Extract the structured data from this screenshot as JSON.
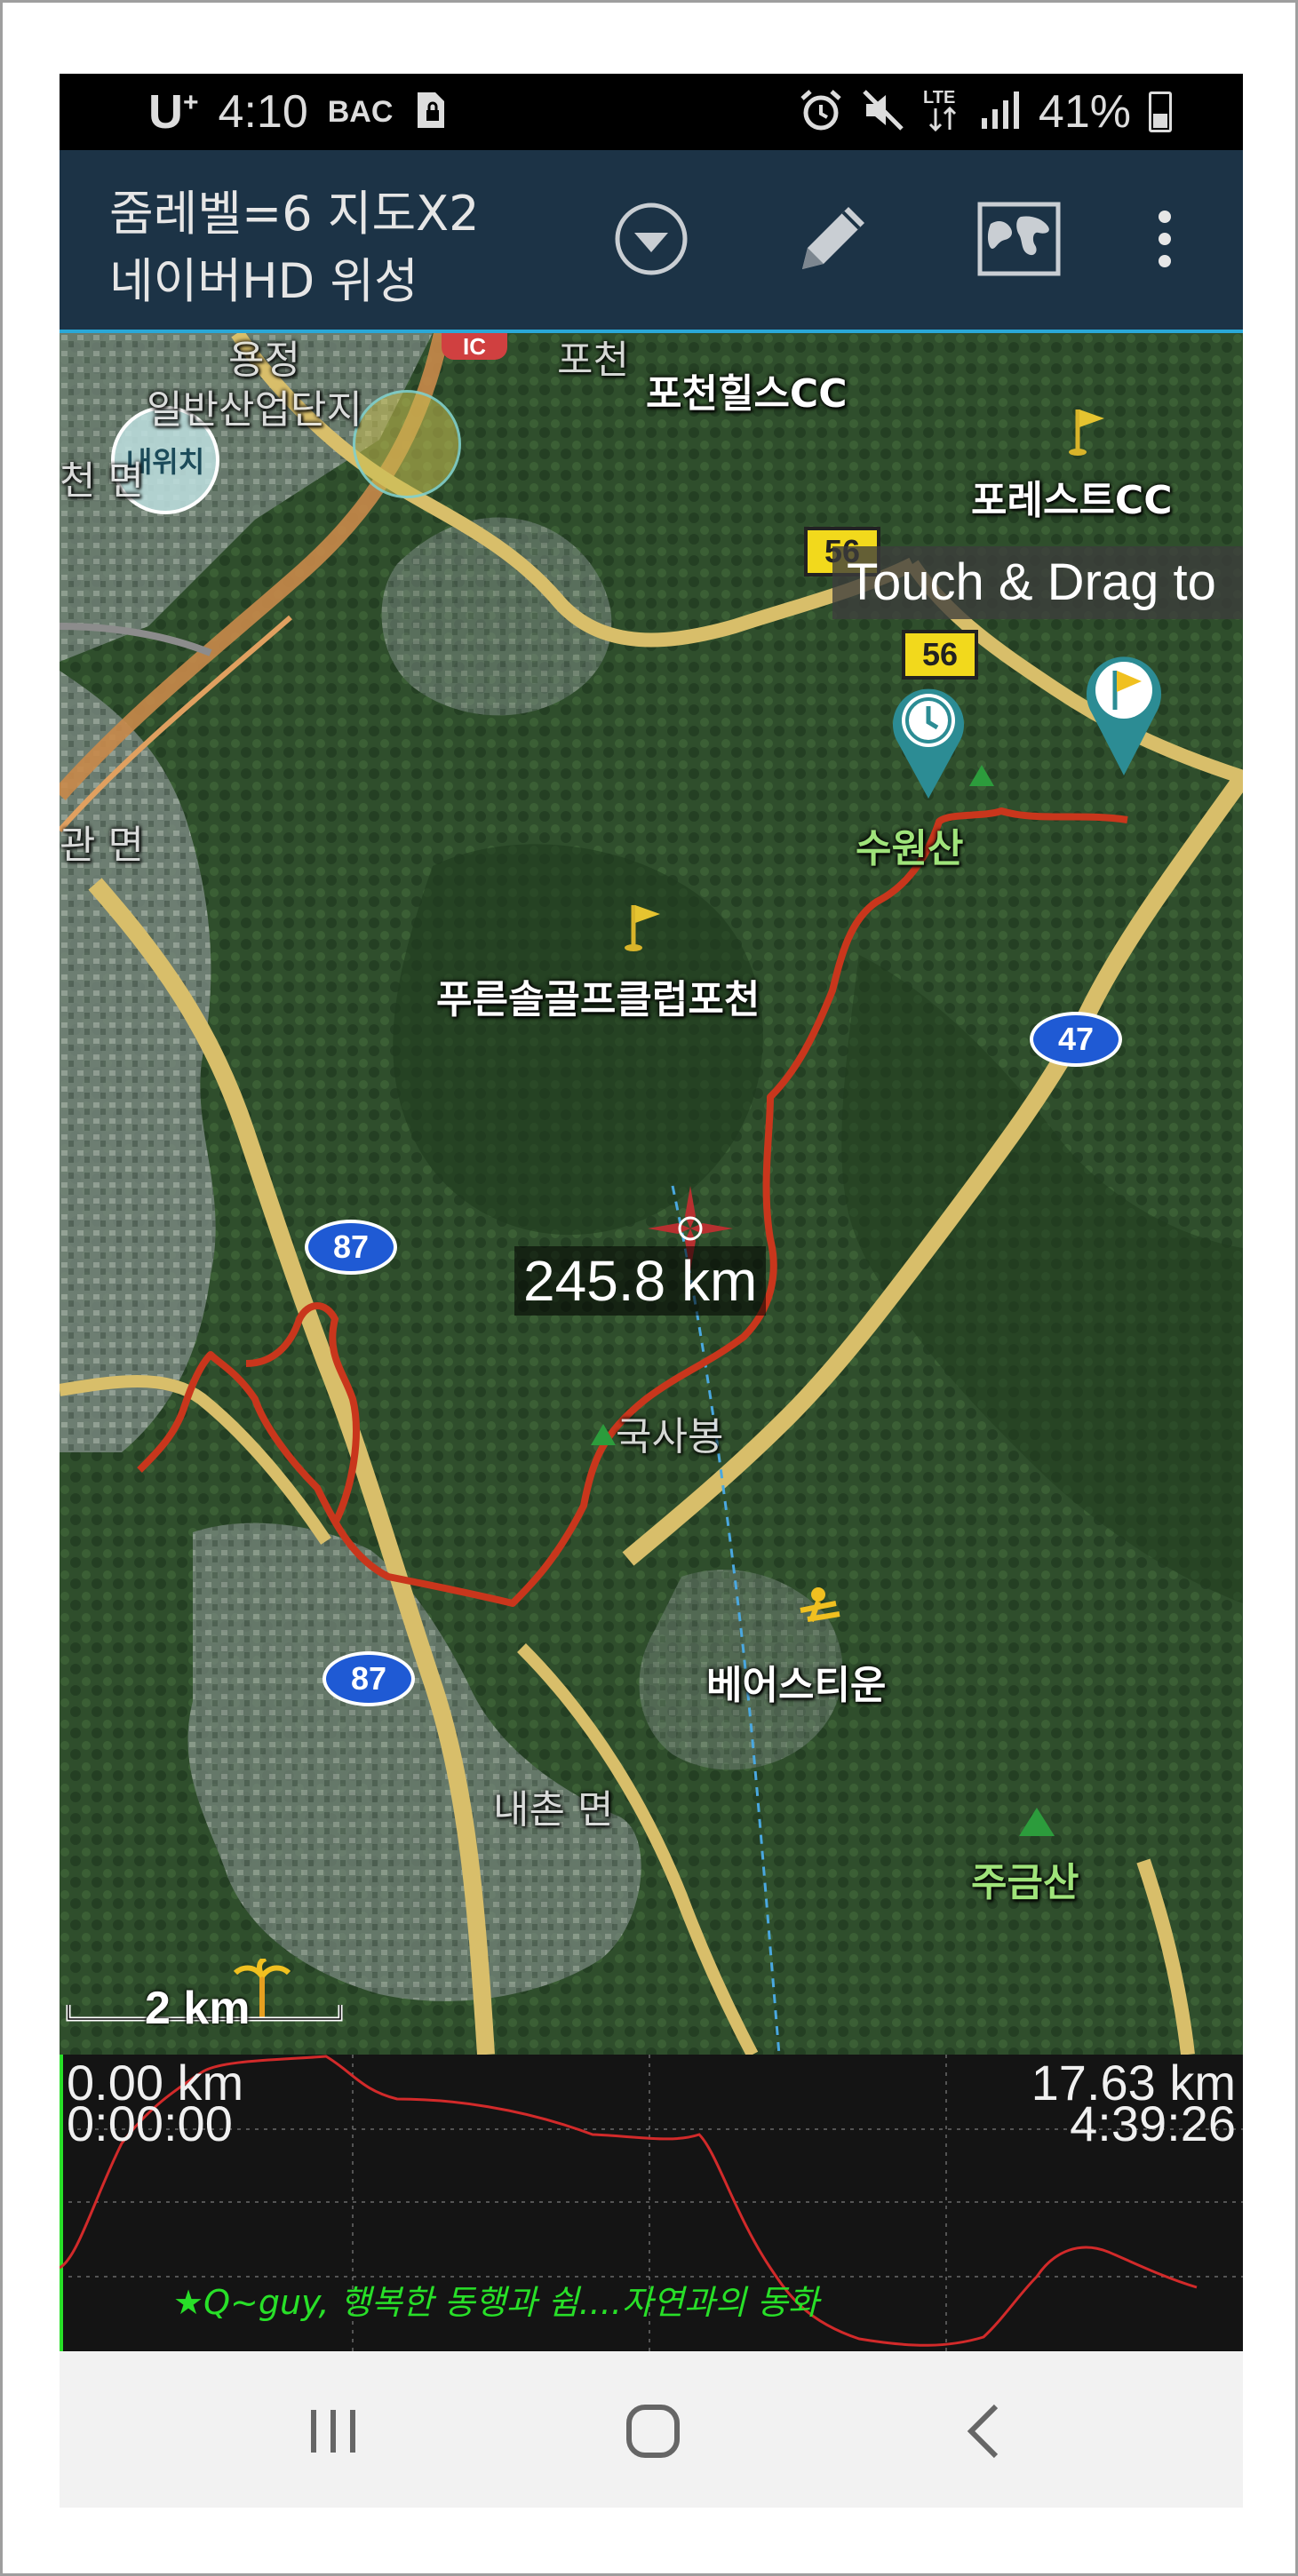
{
  "status_bar": {
    "carrier": "U",
    "carrier_sup": "+",
    "time": "4:10",
    "indicator_1": "BAC",
    "battery_percent": "41%",
    "battery_level": 0.41,
    "network": "LTE"
  },
  "toolbar": {
    "title_line1": "줌레벨=6 지도X2",
    "title_line2": "네이버HD 위성"
  },
  "map": {
    "my_location_label": "내위치",
    "touch_drag_hint": "Touch & Drag to",
    "distance_label": "245.8 km",
    "scale_label": "2 km",
    "place_labels": {
      "pocheon_hills": "포천힐스CC",
      "forest_cc": "포레스트CC",
      "suwonsan": "수원산",
      "pureunsol": "푸른솔골프클럽포천",
      "guksabong": "국사봉",
      "bearstown": "베어스티운",
      "naechon": "내촌 면",
      "jugeumsan": "주금산",
      "industrial": "일반산업단지",
      "yongjeong": "용정",
      "pocheon_ic": "포천",
      "myeon_left": "관 면",
      "left_edge_1": "천 면"
    },
    "road_shields": {
      "r56a": "56",
      "r56b": "56",
      "r47": "47",
      "r87a": "87",
      "r87b": "87",
      "ic": "IC"
    }
  },
  "elevation": {
    "start_distance": "0.00 km",
    "start_time": "0:00:00",
    "end_distance": "17.63 km",
    "end_time": "4:39:26",
    "quote": "★Q~guy, 행복한 동행과 쉼....자연과의 동화"
  },
  "colors": {
    "toolbar_bg": "#1c3346",
    "track": "#c9361c",
    "elevation_line": "#d22a2a",
    "quote": "#28e028"
  }
}
